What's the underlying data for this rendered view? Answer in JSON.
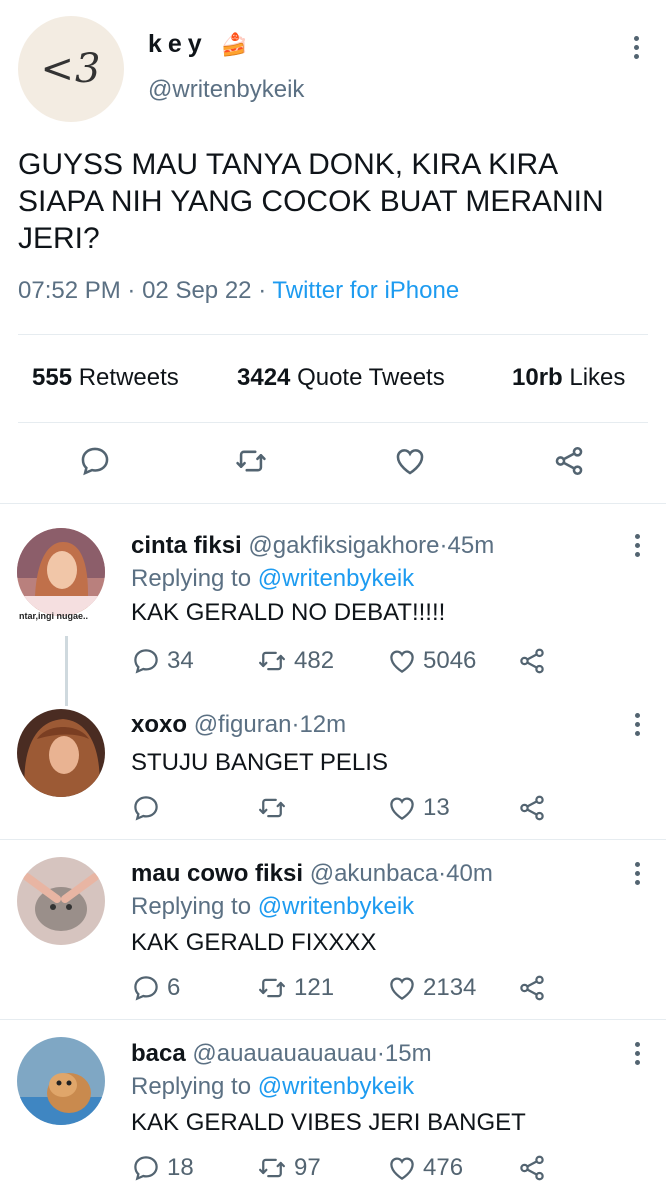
{
  "tweet": {
    "avatar_text": "<3",
    "display_name": "key",
    "name_emoji": "🍰",
    "handle": "@writenbykeik",
    "text": "GUYSS MAU TANYA DONK, KIRA KIRA SIAPA NIH YANG COCOK BUAT MERANIN JERI?",
    "time": "07:52 PM",
    "date": "02 Sep 22",
    "source": "Twitter for iPhone",
    "sep": "·",
    "stats": {
      "retweets_count": "555",
      "retweets_label": "Retweets",
      "quotes_count": "3424",
      "quotes_label": "Quote Tweets",
      "likes_count": "10rb",
      "likes_label": "Likes"
    }
  },
  "replies": [
    {
      "name": "cinta fiksi",
      "handle": "@gakfiksigakhore",
      "time": "45m",
      "replying_prefix": "Replying to",
      "replying_to": "@writenbykeik",
      "text": "KAK GERALD NO DEBAT!!!!!",
      "avatar_caption": "ntar,ingi nugae..",
      "replies": "34",
      "retweets": "482",
      "likes": "5046"
    },
    {
      "name": "xoxo",
      "handle": "@figuran",
      "time": "12m",
      "text": "STUJU BANGET PELIS",
      "replies": "",
      "retweets": "",
      "likes": "13"
    },
    {
      "name": "mau cowo fiksi",
      "handle": "@akunbaca",
      "time": "40m",
      "replying_prefix": "Replying to",
      "replying_to": "@writenbykeik",
      "text": "KAK GERALD FIXXXX",
      "replies": "6",
      "retweets": "121",
      "likes": "2134"
    },
    {
      "name": "baca",
      "handle": "@auauauauauau",
      "time": "15m",
      "replying_prefix": "Replying to",
      "replying_to": "@writenbykeik",
      "text": "KAK GERALD VIBES JERI BANGET",
      "replies": "18",
      "retweets": "97",
      "likes": "476"
    }
  ],
  "colors": {
    "accent": "#1d9bf0",
    "muted": "#5b7083",
    "divider": "#e6ecf0"
  }
}
